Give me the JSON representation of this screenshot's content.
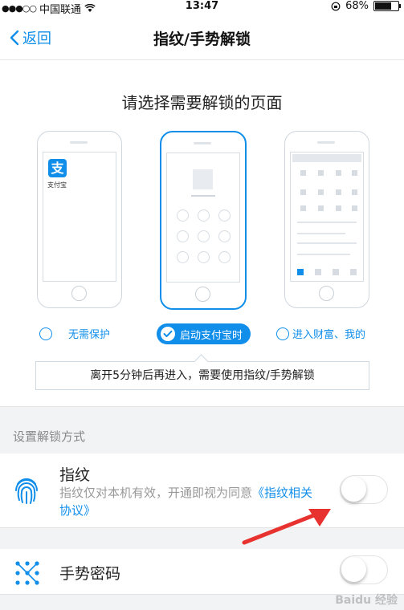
{
  "status_bar": {
    "carrier": "中国联通",
    "time": "13:47",
    "battery_percent": "68%",
    "battery_level": 0.68
  },
  "nav": {
    "back_label": "返回",
    "title": "指纹/手势解锁"
  },
  "page_heading": "请选择需要解锁的页面",
  "phones": {
    "alipay_logo_char": "支",
    "alipay_app_name": "支付宝"
  },
  "options": [
    {
      "label": "无需保护",
      "selected": false
    },
    {
      "label": "启动支付宝时",
      "selected": true
    },
    {
      "label": "进入财富、我的",
      "selected": false
    }
  ],
  "tip": "离开5分钟后再进入，需要使用指纹/手势解锁",
  "unlock_section": {
    "label": "设置解锁方式",
    "fingerprint": {
      "title": "指纹",
      "desc_prefix": "指纹仅对本机有效，开通即视为同意",
      "desc_link": "《指纹相关协议》",
      "enabled": false
    },
    "gesture": {
      "title": "手势密码",
      "enabled": false
    }
  },
  "watermark": "Baidu 经验",
  "colors": {
    "accent": "#108ee9",
    "arrow": "#e8322f",
    "section_bg": "#f2f3f5"
  },
  "icons": {
    "back": "chevron-left-icon",
    "fingerprint": "fingerprint-icon",
    "gesture": "gesture-pattern-icon",
    "wifi": "wifi-icon",
    "check": "check-icon"
  }
}
